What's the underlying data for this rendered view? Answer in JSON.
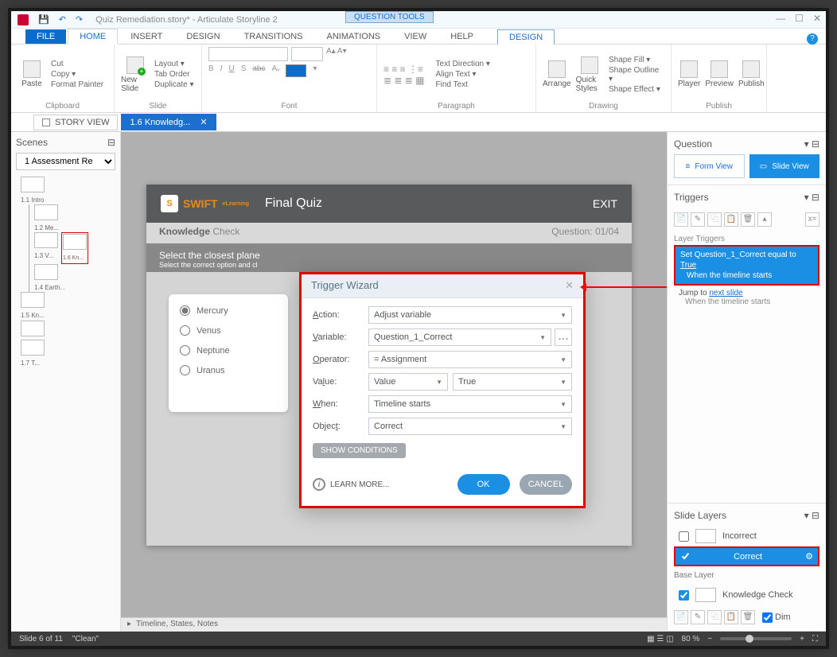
{
  "titlebar": {
    "file": "Quiz Remediation.story* - Articulate Storyline 2",
    "qtools": "QUESTION TOOLS"
  },
  "tabs": {
    "file": "FILE",
    "home": "HOME",
    "insert": "INSERT",
    "design": "DESIGN",
    "transitions": "TRANSITIONS",
    "animations": "ANIMATIONS",
    "view": "VIEW",
    "help": "HELP",
    "design2": "DESIGN"
  },
  "ribbon": {
    "clipboard": {
      "label": "Clipboard",
      "paste": "Paste",
      "cut": "Cut",
      "copy": "Copy ▾",
      "fmt": "Format Painter"
    },
    "slide": {
      "label": "Slide",
      "new": "New Slide",
      "layout": "Layout ▾",
      "tab": "Tab Order",
      "dup": "Duplicate ▾"
    },
    "font": {
      "label": "Font"
    },
    "paragraph": {
      "label": "Paragraph",
      "textdir": "Text Direction ▾",
      "align": "Align Text ▾",
      "find": "Find Text"
    },
    "drawing": {
      "label": "Drawing",
      "arrange": "Arrange",
      "quick": "Quick Styles",
      "fill": "Shape Fill ▾",
      "outline": "Shape Outline ▾",
      "effect": "Shape Effect ▾"
    },
    "publish": {
      "label": "Publish",
      "player": "Player",
      "preview": "Preview",
      "publish": "Publish"
    }
  },
  "doctabs": {
    "story": "STORY VIEW",
    "slide": "1.6 Knowledg..."
  },
  "scenes": {
    "title": "Scenes",
    "dd": "1 Assessment Re",
    "t1": "1.1 Intro",
    "t2": "1.2 Me...",
    "t3": "1.3 V...",
    "t4": "1.4 Earth...",
    "t5": "1.5 Kn...",
    "t6": "1.6 Kn...",
    "t7": "1.7 T..."
  },
  "slide": {
    "brand": "SWIFT",
    "brandTag": "eLearning",
    "title": "Final Quiz",
    "exit": "EXIT",
    "subL": "Knowledge",
    "subL2": " Check",
    "subR": "Question: 01/04",
    "prompt1": "Select the closest plane",
    "prompt2": "Select the correct option and cl",
    "a1": "Mercury",
    "a2": "Venus",
    "a3": "Neptune",
    "a4": "Uranus"
  },
  "canvasFooter": "Timeline, States, Notes",
  "modal": {
    "title": "Trigger Wizard",
    "action_l": "Action:",
    "action_v": "Adjust variable",
    "variable_l": "Variable:",
    "variable_v": "Question_1_Correct",
    "operator_l": "Operator:",
    "operator_v": "= Assignment",
    "value_l": "Value:",
    "value_v1": "Value",
    "value_v2": "True",
    "when_l": "When:",
    "when_v": "Timeline starts",
    "object_l": "Object:",
    "object_v": "Correct",
    "showcond": "SHOW CONDITIONS",
    "learn": "LEARN MORE...",
    "ok": "OK",
    "cancel": "CANCEL"
  },
  "right": {
    "question": "Question",
    "form": "Form View",
    "slidev": "Slide View",
    "triggers": "Triggers",
    "layerTriggers": "Layer Triggers",
    "hl1": "Set Question_1_Correct equal to ",
    "hl1v": "True",
    "hl2": "When the timeline starts",
    "jump": "Jump to ",
    "jumpLink": "next slide",
    "jump2": "When the timeline starts",
    "slideLayers": "Slide Layers",
    "incorrect": "Incorrect",
    "correct": "Correct",
    "base": "Base Layer",
    "kc": "Knowledge Check",
    "dim": "Dim"
  },
  "status": {
    "slide": "Slide 6 of 11",
    "layout": "\"Clean\"",
    "zoom": "80 %"
  }
}
